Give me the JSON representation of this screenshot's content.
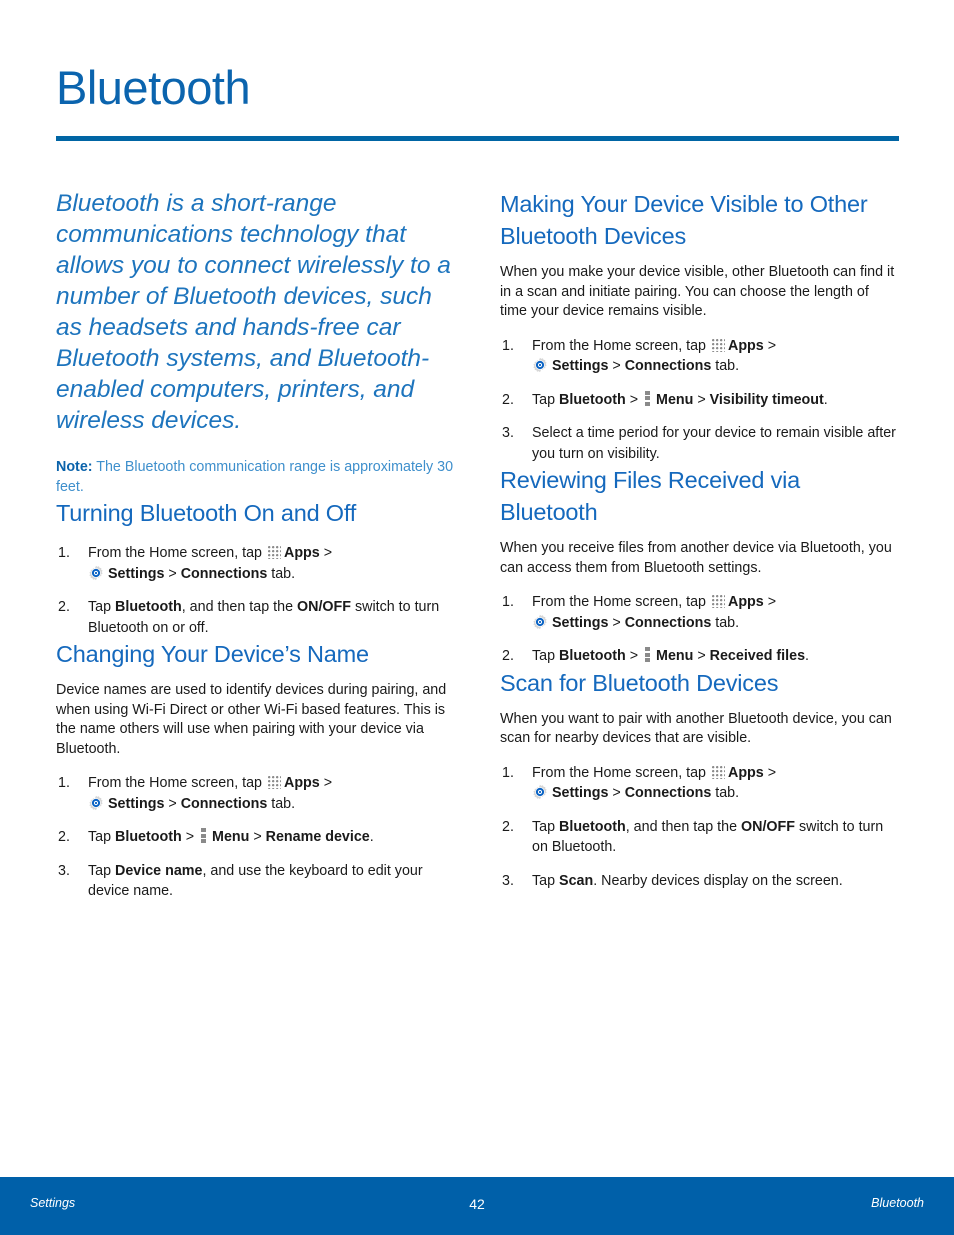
{
  "page": {
    "title": "Bluetooth",
    "intro": "Bluetooth is a short-range communications technology that allows you to connect wirelessly to a number of Bluetooth devices, such as headsets and hands-free car Bluetooth systems, and Bluetooth-enabled computers, printers, and wireless devices.",
    "note": {
      "label": "Note:",
      "text": " The Bluetooth communication range is approximately 30 feet."
    }
  },
  "icons": {
    "apps": "apps-grid-icon",
    "settings": "settings-gear-icon",
    "menu": "menu-vertical-dots-icon"
  },
  "left_column": {
    "sections": [
      {
        "heading": "Turning Bluetooth On and Off",
        "steps": [
          {
            "num": "1.",
            "parts": [
              {
                "t": "text",
                "v": "From the Home screen, tap "
              },
              {
                "t": "icon",
                "v": "apps"
              },
              {
                "t": "bold",
                "v": "Apps"
              },
              {
                "t": "text",
                "v": " > "
              },
              {
                "t": "break"
              },
              {
                "t": "icon",
                "v": "settings"
              },
              {
                "t": "bold",
                "v": "Settings"
              },
              {
                "t": "text",
                "v": " > "
              },
              {
                "t": "bold",
                "v": "Connections"
              },
              {
                "t": "text",
                "v": " tab."
              }
            ]
          },
          {
            "num": "2.",
            "parts": [
              {
                "t": "text",
                "v": "Tap "
              },
              {
                "t": "bold",
                "v": "Bluetooth"
              },
              {
                "t": "text",
                "v": ", and then tap the "
              },
              {
                "t": "bold",
                "v": "ON/OFF"
              },
              {
                "t": "text",
                "v": " switch to turn Bluetooth on or off."
              }
            ]
          }
        ]
      },
      {
        "heading": "Changing Your Device’s Name",
        "body": "Device names are used to identify devices during pairing, and when using Wi-Fi Direct or other Wi-Fi based features. This is the name others will use when pairing with your device via Bluetooth.",
        "steps": [
          {
            "num": "1.",
            "parts": [
              {
                "t": "text",
                "v": "From the Home screen, tap "
              },
              {
                "t": "icon",
                "v": "apps"
              },
              {
                "t": "bold",
                "v": "Apps"
              },
              {
                "t": "text",
                "v": " > "
              },
              {
                "t": "break"
              },
              {
                "t": "icon",
                "v": "settings"
              },
              {
                "t": "bold",
                "v": "Settings"
              },
              {
                "t": "text",
                "v": " > "
              },
              {
                "t": "bold",
                "v": "Connections"
              },
              {
                "t": "text",
                "v": " tab."
              }
            ]
          },
          {
            "num": "2.",
            "parts": [
              {
                "t": "text",
                "v": "Tap "
              },
              {
                "t": "bold",
                "v": "Bluetooth"
              },
              {
                "t": "text",
                "v": " > "
              },
              {
                "t": "icon",
                "v": "menu"
              },
              {
                "t": "bold",
                "v": "Menu"
              },
              {
                "t": "text",
                "v": " > "
              },
              {
                "t": "bold",
                "v": "Rename device"
              },
              {
                "t": "text",
                "v": "."
              }
            ]
          },
          {
            "num": "3.",
            "parts": [
              {
                "t": "text",
                "v": "Tap "
              },
              {
                "t": "bold",
                "v": "Device name"
              },
              {
                "t": "text",
                "v": ", and use the keyboard to edit your device name."
              }
            ]
          }
        ]
      }
    ]
  },
  "right_column": {
    "sections": [
      {
        "heading": "Making Your Device Visible to Other Bluetooth Devices",
        "body": "When you make your device visible, other Bluetooth can find it in a scan and initiate pairing. You can choose the length of time your device remains visible.",
        "steps": [
          {
            "num": "1.",
            "parts": [
              {
                "t": "text",
                "v": "From the Home screen, tap "
              },
              {
                "t": "icon",
                "v": "apps"
              },
              {
                "t": "bold",
                "v": "Apps"
              },
              {
                "t": "text",
                "v": " > "
              },
              {
                "t": "break"
              },
              {
                "t": "icon",
                "v": "settings"
              },
              {
                "t": "bold",
                "v": "Settings"
              },
              {
                "t": "text",
                "v": " > "
              },
              {
                "t": "bold",
                "v": "Connections"
              },
              {
                "t": "text",
                "v": " tab."
              }
            ]
          },
          {
            "num": "2.",
            "parts": [
              {
                "t": "text",
                "v": "Tap "
              },
              {
                "t": "bold",
                "v": "Bluetooth"
              },
              {
                "t": "text",
                "v": " > "
              },
              {
                "t": "icon",
                "v": "menu"
              },
              {
                "t": "bold",
                "v": "Menu"
              },
              {
                "t": "text",
                "v": " > "
              },
              {
                "t": "bold",
                "v": "Visibility timeout"
              },
              {
                "t": "text",
                "v": "."
              }
            ]
          },
          {
            "num": "3.",
            "parts": [
              {
                "t": "text",
                "v": "Select a time period for your device to remain visible after you turn on visibility."
              }
            ]
          }
        ]
      },
      {
        "heading": "Reviewing Files Received via Bluetooth",
        "body": "When you receive files from another device via Bluetooth, you can access them from Bluetooth settings.",
        "steps": [
          {
            "num": "1.",
            "parts": [
              {
                "t": "text",
                "v": "From the Home screen, tap "
              },
              {
                "t": "icon",
                "v": "apps"
              },
              {
                "t": "bold",
                "v": "Apps"
              },
              {
                "t": "text",
                "v": " > "
              },
              {
                "t": "break"
              },
              {
                "t": "icon",
                "v": "settings"
              },
              {
                "t": "bold",
                "v": "Settings"
              },
              {
                "t": "text",
                "v": " > "
              },
              {
                "t": "bold",
                "v": "Connections"
              },
              {
                "t": "text",
                "v": " tab."
              }
            ]
          },
          {
            "num": "2.",
            "parts": [
              {
                "t": "text",
                "v": "Tap "
              },
              {
                "t": "bold",
                "v": "Bluetooth"
              },
              {
                "t": "text",
                "v": " > "
              },
              {
                "t": "icon",
                "v": "menu"
              },
              {
                "t": "bold",
                "v": "Menu"
              },
              {
                "t": "text",
                "v": " > "
              },
              {
                "t": "bold",
                "v": "Received files"
              },
              {
                "t": "text",
                "v": "."
              }
            ]
          }
        ]
      },
      {
        "heading": "Scan for Bluetooth Devices",
        "body": "When you want to pair with another Bluetooth device, you can scan for nearby devices that are visible.",
        "steps": [
          {
            "num": "1.",
            "parts": [
              {
                "t": "text",
                "v": "From the Home screen, tap "
              },
              {
                "t": "icon",
                "v": "apps"
              },
              {
                "t": "bold",
                "v": "Apps"
              },
              {
                "t": "text",
                "v": " > "
              },
              {
                "t": "break"
              },
              {
                "t": "icon",
                "v": "settings"
              },
              {
                "t": "bold",
                "v": "Settings"
              },
              {
                "t": "text",
                "v": " > "
              },
              {
                "t": "bold",
                "v": "Connections"
              },
              {
                "t": "text",
                "v": " tab."
              }
            ]
          },
          {
            "num": "2.",
            "parts": [
              {
                "t": "text",
                "v": "Tap "
              },
              {
                "t": "bold",
                "v": "Bluetooth"
              },
              {
                "t": "text",
                "v": ", and then tap the "
              },
              {
                "t": "bold",
                "v": "ON/OFF"
              },
              {
                "t": "text",
                "v": " switch to turn on Bluetooth."
              }
            ]
          },
          {
            "num": "3.",
            "parts": [
              {
                "t": "text",
                "v": "Tap "
              },
              {
                "t": "bold",
                "v": "Scan"
              },
              {
                "t": "text",
                "v": ". Nearby devices display on the screen."
              }
            ]
          }
        ]
      }
    ]
  },
  "footer": {
    "left": "Settings",
    "page_number": "42",
    "right": "Bluetooth"
  },
  "colors": {
    "title_blue": "#0b64ae",
    "rule_blue": "#0065a4",
    "heading_blue": "#1569bd",
    "intro_blue": "#1d74bd",
    "note_label_blue": "#0b63ab",
    "note_text_blue": "#3e8fcc",
    "footer_blue": "#0060a9",
    "body_text": "#1a1a1a"
  }
}
